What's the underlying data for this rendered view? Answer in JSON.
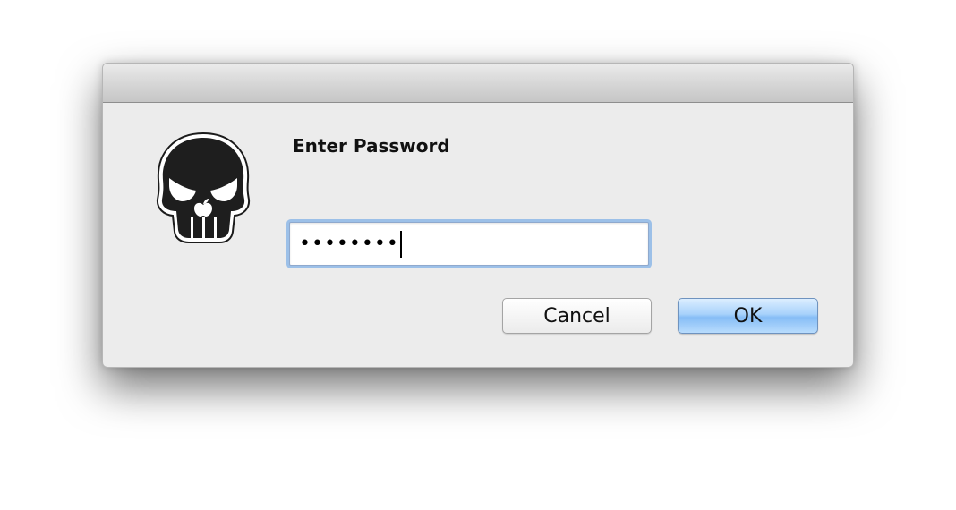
{
  "dialog": {
    "title": "Enter Password",
    "password_masked": "••••••••",
    "icon": "skull-apple-icon"
  },
  "buttons": {
    "cancel_label": "Cancel",
    "ok_label": "OK"
  },
  "colors": {
    "dialog_background": "#ececec",
    "focus_ring": "#9cc0e8",
    "default_button": "#a8d2fb"
  }
}
